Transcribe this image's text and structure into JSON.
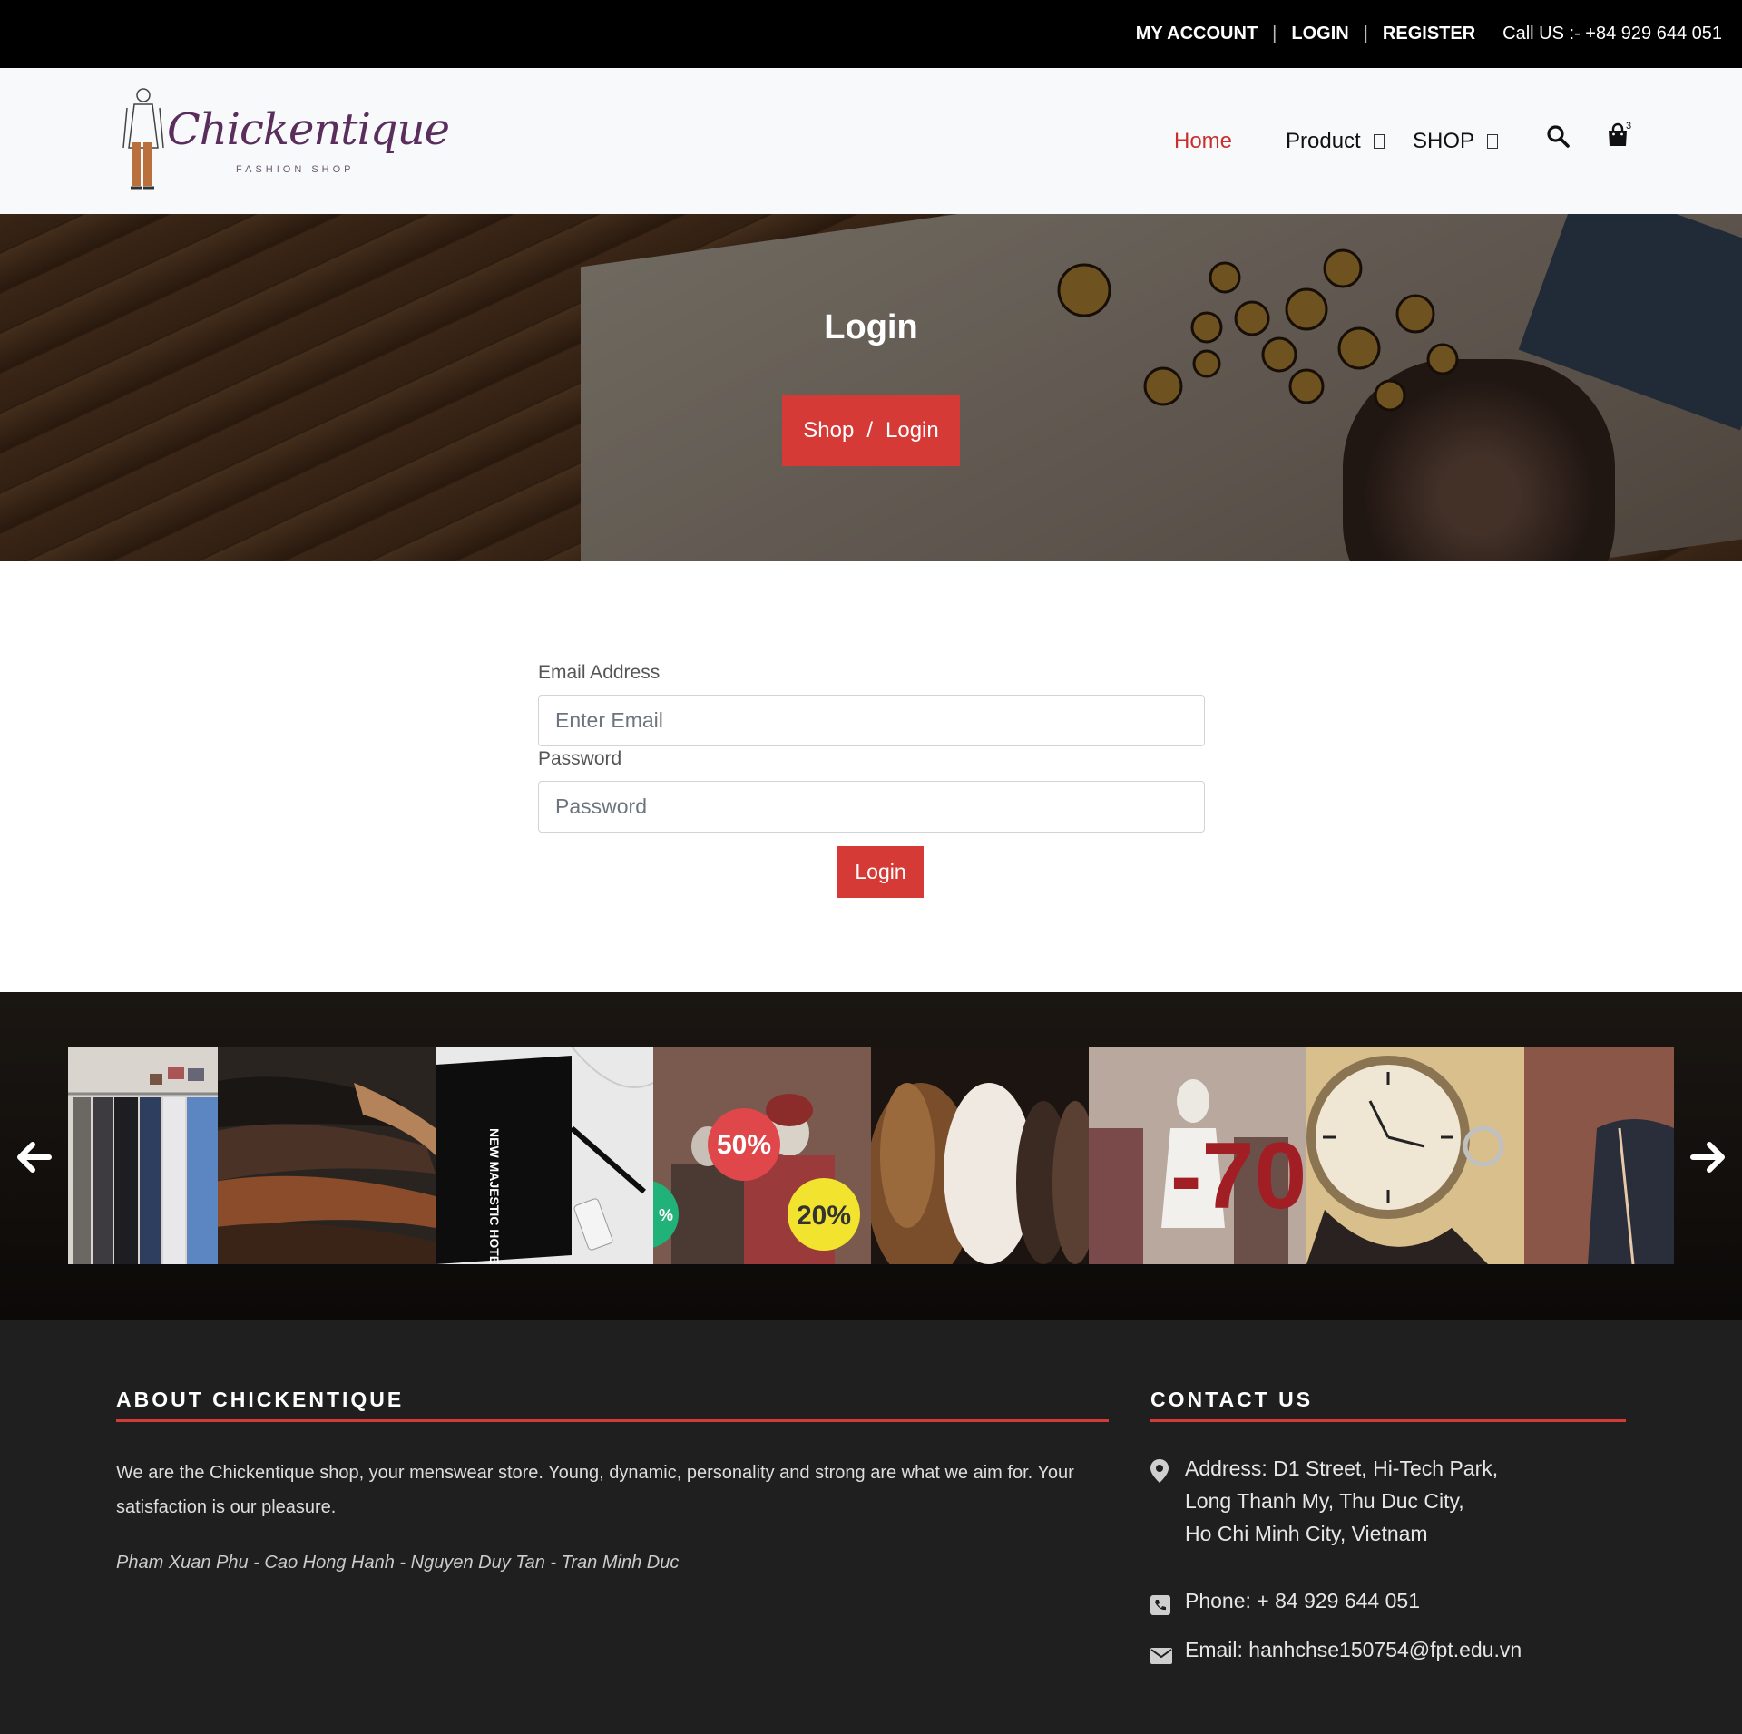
{
  "topbar": {
    "my_account": "MY ACCOUNT",
    "login": "LOGIN",
    "register": "REGISTER",
    "call": "Call US :- +84 929 644 051"
  },
  "logo": {
    "name": "Chickentique",
    "sub": "FASHION SHOP"
  },
  "nav": {
    "home": "Home",
    "product": "Product",
    "shop": "SHOP",
    "cart_count": "3"
  },
  "hero": {
    "title": "Login",
    "breadcrumb": [
      "Shop",
      "/",
      "Login"
    ]
  },
  "form": {
    "email_label": "Email Address",
    "email_placeholder": "Enter Email",
    "password_label": "Password",
    "password_placeholder": "Password",
    "submit": "Login"
  },
  "gallery": {
    "tiles": [
      {
        "name": "clothes-rack"
      },
      {
        "name": "leather-shoes"
      },
      {
        "name": "tote-bag",
        "text": "NEW MAJESTIC HOTEL"
      },
      {
        "name": "sale-mannequins",
        "badges": [
          "50%",
          "20%",
          "%"
        ]
      },
      {
        "name": "fur-coats"
      },
      {
        "name": "sale-70",
        "text": "-70"
      },
      {
        "name": "wristwatch"
      },
      {
        "name": "tailor-suit"
      }
    ]
  },
  "footer": {
    "about_title": "ABOUT CHICKENTIQUE",
    "about_text": "We are the Chickentique shop, your menswear store. Young, dynamic, personality and strong are what we aim for. Your satisfaction is our pleasure.",
    "authors": "Pham Xuan Phu - Cao Hong Hanh - Nguyen Duy Tan - Tran Minh Duc",
    "contact_title": "CONTACT US",
    "address_lines": [
      "Address: D1 Street, Hi-Tech Park,",
      "Long Thanh My, Thu Duc City,",
      "Ho Chi Minh City, Vietnam"
    ],
    "phone": "Phone: + 84 929 644 051",
    "email": "Email: hanhchse150754@fpt.edu.vn"
  },
  "colors": {
    "accent": "#d63a36",
    "topbar": "#000000",
    "footer": "#1f1f1f",
    "logo": "#5a2e5c"
  }
}
